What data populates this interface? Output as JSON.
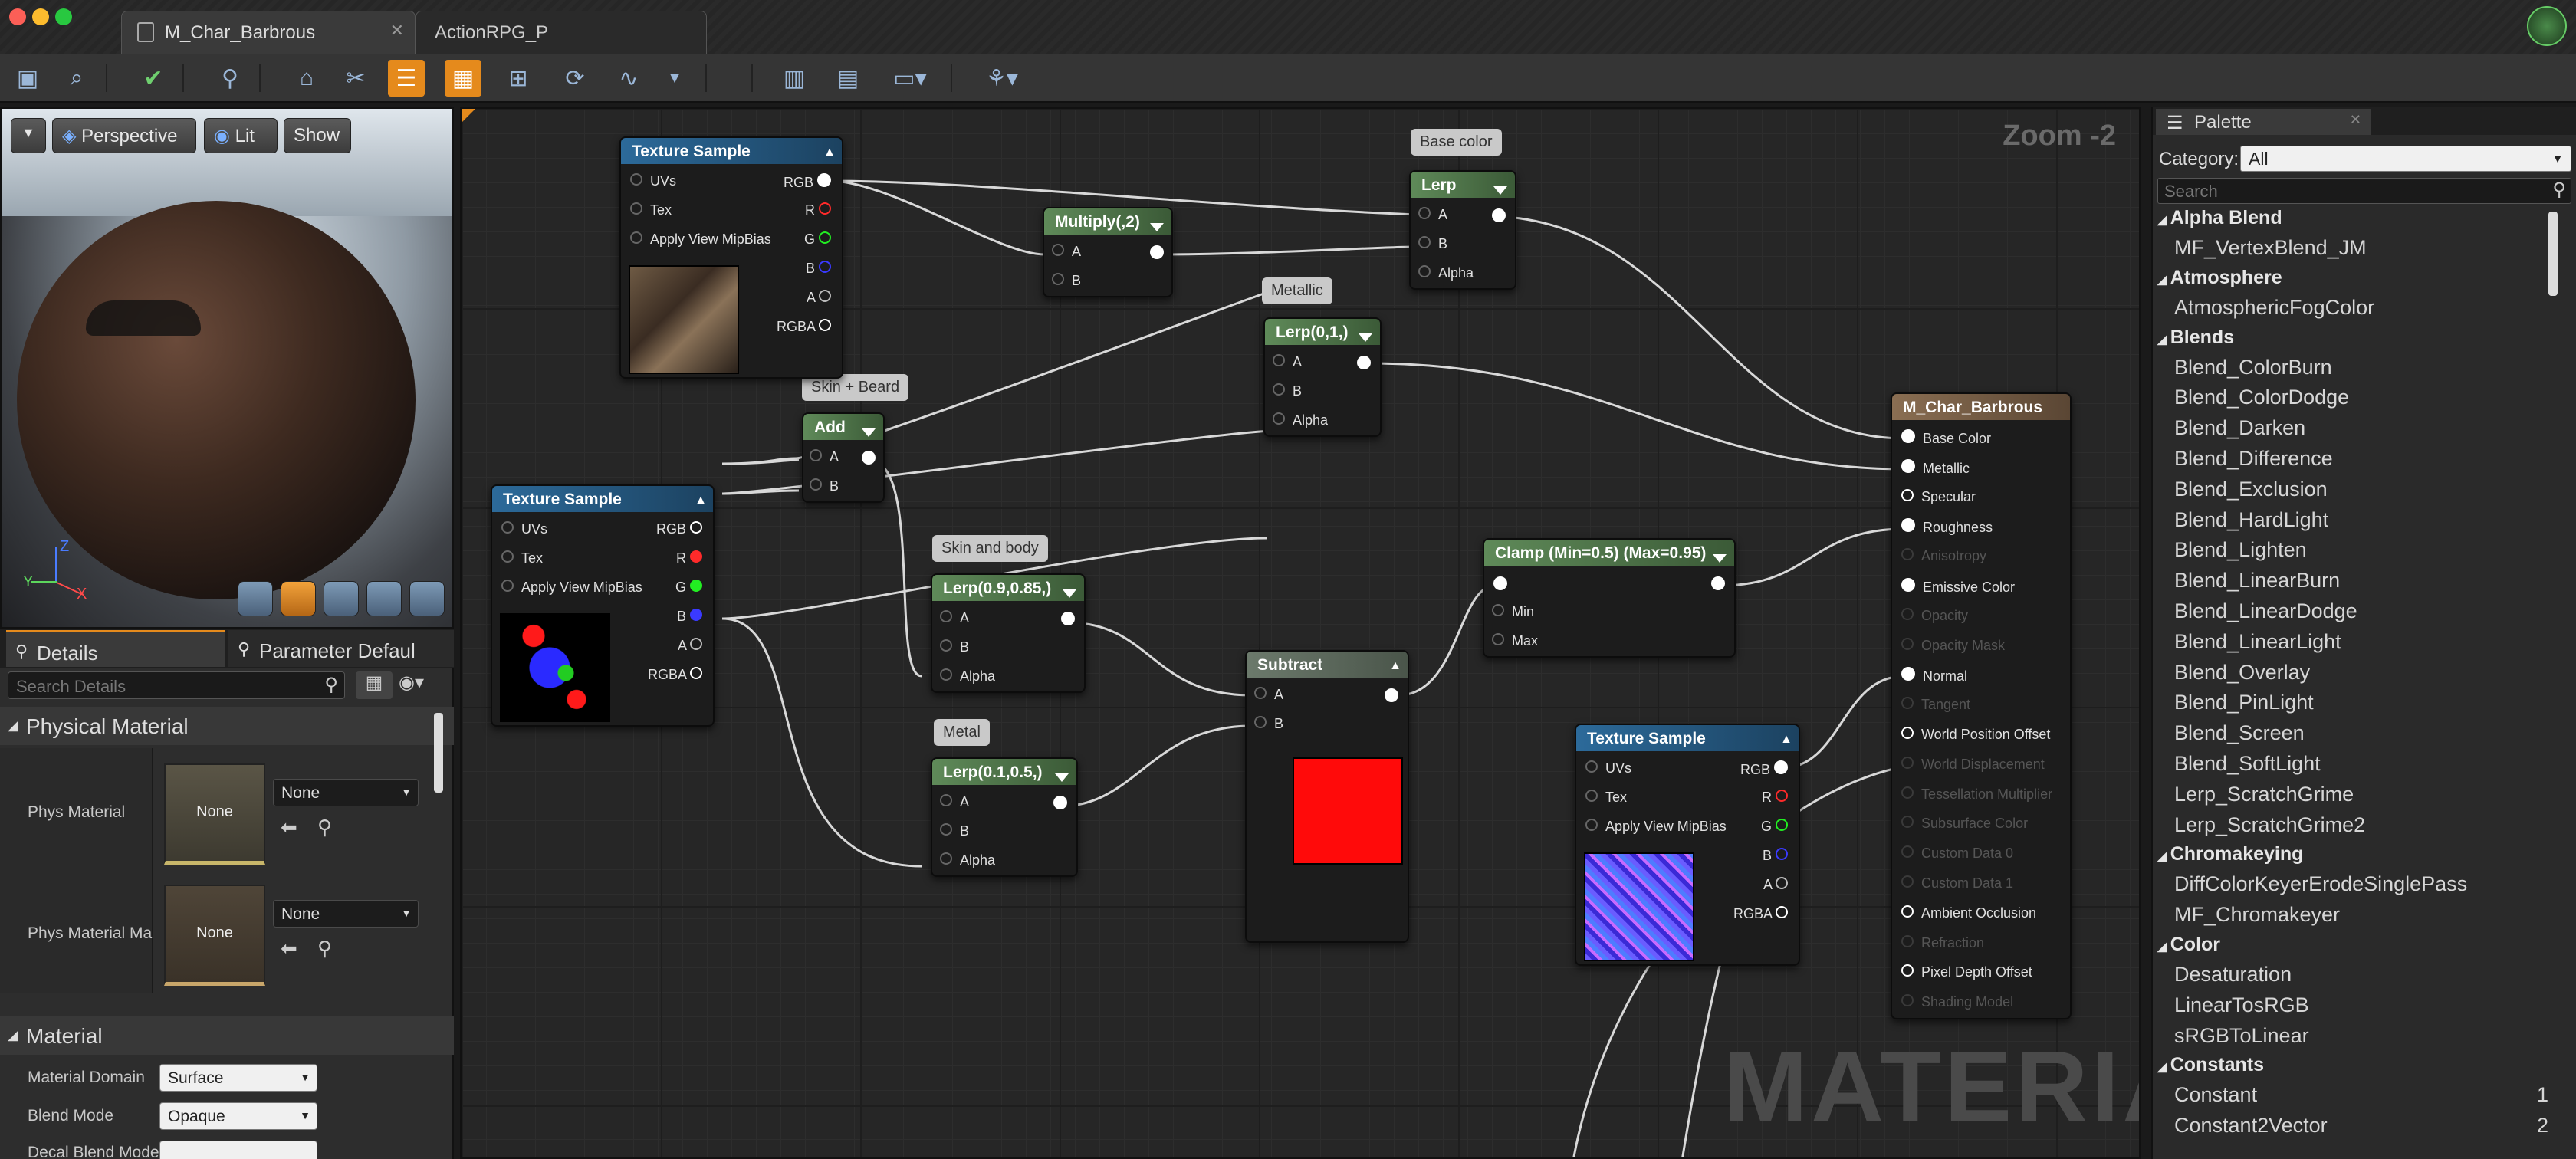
{
  "tabs": {
    "active": "M_Char_Barbrous",
    "inactive": "ActionRPG_P"
  },
  "toolbar_icons": [
    "save-icon",
    "browse-icon",
    "apply-icon",
    "search-icon",
    "home-icon",
    "clean-icon",
    "show-icon",
    "preview-node-icon",
    "live-preview-icon",
    "live-nodes-icon",
    "live-update-icon",
    "hierarchy-icon",
    "stats-icon",
    "mobile-stats-icon",
    "platform-stats-icon",
    "quality-icon"
  ],
  "viewport": {
    "perspective": "Perspective",
    "lit": "Lit",
    "show": "Show"
  },
  "details": {
    "tab_details": "Details",
    "tab_params": "Parameter Defaul",
    "search_placeholder": "Search Details",
    "section_physical": "Physical Material",
    "phys_material_label": "Phys Material",
    "phys_material_thumb": "None",
    "phys_material_value": "None",
    "phys_material_mask_label": "Phys Material Ma",
    "phys_material_mask_thumb": "None",
    "phys_material_mask_value": "None",
    "section_material": "Material",
    "material_domain_label": "Material Domain",
    "material_domain_value": "Surface",
    "blend_mode_label": "Blend Mode",
    "blend_mode_value": "Opaque",
    "decal_label": "Decal Blend Mode"
  },
  "graph": {
    "zoom": "Zoom -2",
    "watermark": "MATERIAL",
    "comments": {
      "base_color": "Base color",
      "metallic": "Metallic",
      "skin_beard": "Skin + Beard",
      "skin_body": "Skin and body",
      "metal": "Metal"
    },
    "tex1": {
      "title": "Texture Sample",
      "uvs": "UVs",
      "tex": "Tex",
      "mip": "Apply View MipBias",
      "rgb": "RGB",
      "r": "R",
      "g": "G",
      "b": "B",
      "a": "A",
      "rgba": "RGBA"
    },
    "tex2": {
      "title": "Texture Sample",
      "uvs": "UVs",
      "tex": "Tex",
      "mip": "Apply View MipBias",
      "rgb": "RGB",
      "r": "R",
      "g": "G",
      "b": "B",
      "a": "A",
      "rgba": "RGBA"
    },
    "tex3": {
      "title": "Texture Sample",
      "uvs": "UVs",
      "tex": "Tex",
      "mip": "Apply View MipBias",
      "rgb": "RGB",
      "r": "R",
      "g": "G",
      "b": "B",
      "a": "A",
      "rgba": "RGBA"
    },
    "multiply": {
      "title": "Multiply(,2)",
      "a": "A",
      "b": "B"
    },
    "lerp": {
      "title": "Lerp",
      "a": "A",
      "b": "B",
      "alpha": "Alpha"
    },
    "lerp01": {
      "title": "Lerp(0,1,)",
      "a": "A",
      "b": "B",
      "alpha": "Alpha"
    },
    "add": {
      "title": "Add",
      "a": "A",
      "b": "B"
    },
    "lerp09": {
      "title": "Lerp(0.9,0.85,)",
      "a": "A",
      "b": "B",
      "alpha": "Alpha"
    },
    "lerp01b": {
      "title": "Lerp(0.1,0.5,)",
      "a": "A",
      "b": "B",
      "alpha": "Alpha"
    },
    "subtract": {
      "title": "Subtract",
      "a": "A",
      "b": "B"
    },
    "clamp": {
      "title": "Clamp (Min=0.5) (Max=0.95)",
      "min": "Min",
      "max": "Max"
    },
    "result": {
      "title": "M_Char_Barbrous",
      "pins": [
        "Base Color",
        "Metallic",
        "Specular",
        "Roughness",
        "Anisotropy",
        "Emissive Color",
        "Opacity",
        "Opacity Mask",
        "Normal",
        "Tangent",
        "World Position Offset",
        "World Displacement",
        "Tessellation Multiplier",
        "Subsurface Color",
        "Custom Data 0",
        "Custom Data 1",
        "Ambient Occlusion",
        "Refraction",
        "Pixel Depth Offset",
        "Shading Model"
      ],
      "enabled": [
        true,
        true,
        true,
        true,
        false,
        true,
        false,
        false,
        true,
        false,
        true,
        false,
        false,
        false,
        false,
        false,
        true,
        false,
        true,
        false
      ]
    }
  },
  "palette": {
    "title": "Palette",
    "category_label": "Category:",
    "category_value": "All",
    "search_placeholder": "Search",
    "list": [
      {
        "type": "cat",
        "text": "Alpha Blend"
      },
      {
        "type": "item",
        "text": "MF_VertexBlend_JM"
      },
      {
        "type": "cat",
        "text": "Atmosphere"
      },
      {
        "type": "item",
        "text": "AtmosphericFogColor"
      },
      {
        "type": "cat",
        "text": "Blends"
      },
      {
        "type": "item",
        "text": "Blend_ColorBurn"
      },
      {
        "type": "item",
        "text": "Blend_ColorDodge"
      },
      {
        "type": "item",
        "text": "Blend_Darken"
      },
      {
        "type": "item",
        "text": "Blend_Difference"
      },
      {
        "type": "item",
        "text": "Blend_Exclusion"
      },
      {
        "type": "item",
        "text": "Blend_HardLight"
      },
      {
        "type": "item",
        "text": "Blend_Lighten"
      },
      {
        "type": "item",
        "text": "Blend_LinearBurn"
      },
      {
        "type": "item",
        "text": "Blend_LinearDodge"
      },
      {
        "type": "item",
        "text": "Blend_LinearLight"
      },
      {
        "type": "item",
        "text": "Blend_Overlay"
      },
      {
        "type": "item",
        "text": "Blend_PinLight"
      },
      {
        "type": "item",
        "text": "Blend_Screen"
      },
      {
        "type": "item",
        "text": "Blend_SoftLight"
      },
      {
        "type": "item",
        "text": "Lerp_ScratchGrime"
      },
      {
        "type": "item",
        "text": "Lerp_ScratchGrime2"
      },
      {
        "type": "cat",
        "text": "Chromakeying"
      },
      {
        "type": "item",
        "text": "DiffColorKeyerErodeSinglePass"
      },
      {
        "type": "item",
        "text": "MF_Chromakeyer"
      },
      {
        "type": "cat",
        "text": "Color"
      },
      {
        "type": "item",
        "text": "Desaturation"
      },
      {
        "type": "item",
        "text": "LinearTosRGB"
      },
      {
        "type": "item",
        "text": "sRGBToLinear"
      },
      {
        "type": "cat",
        "text": "Constants"
      },
      {
        "type": "item",
        "text": "Constant",
        "hotkey": "1"
      },
      {
        "type": "item",
        "text": "Constant2Vector",
        "hotkey": "2"
      }
    ]
  },
  "colors": {
    "accent_orange": "#e58a1c",
    "pin_red": "#ff2a2a",
    "pin_green": "#22ee22",
    "pin_blue": "#3a3aff"
  }
}
